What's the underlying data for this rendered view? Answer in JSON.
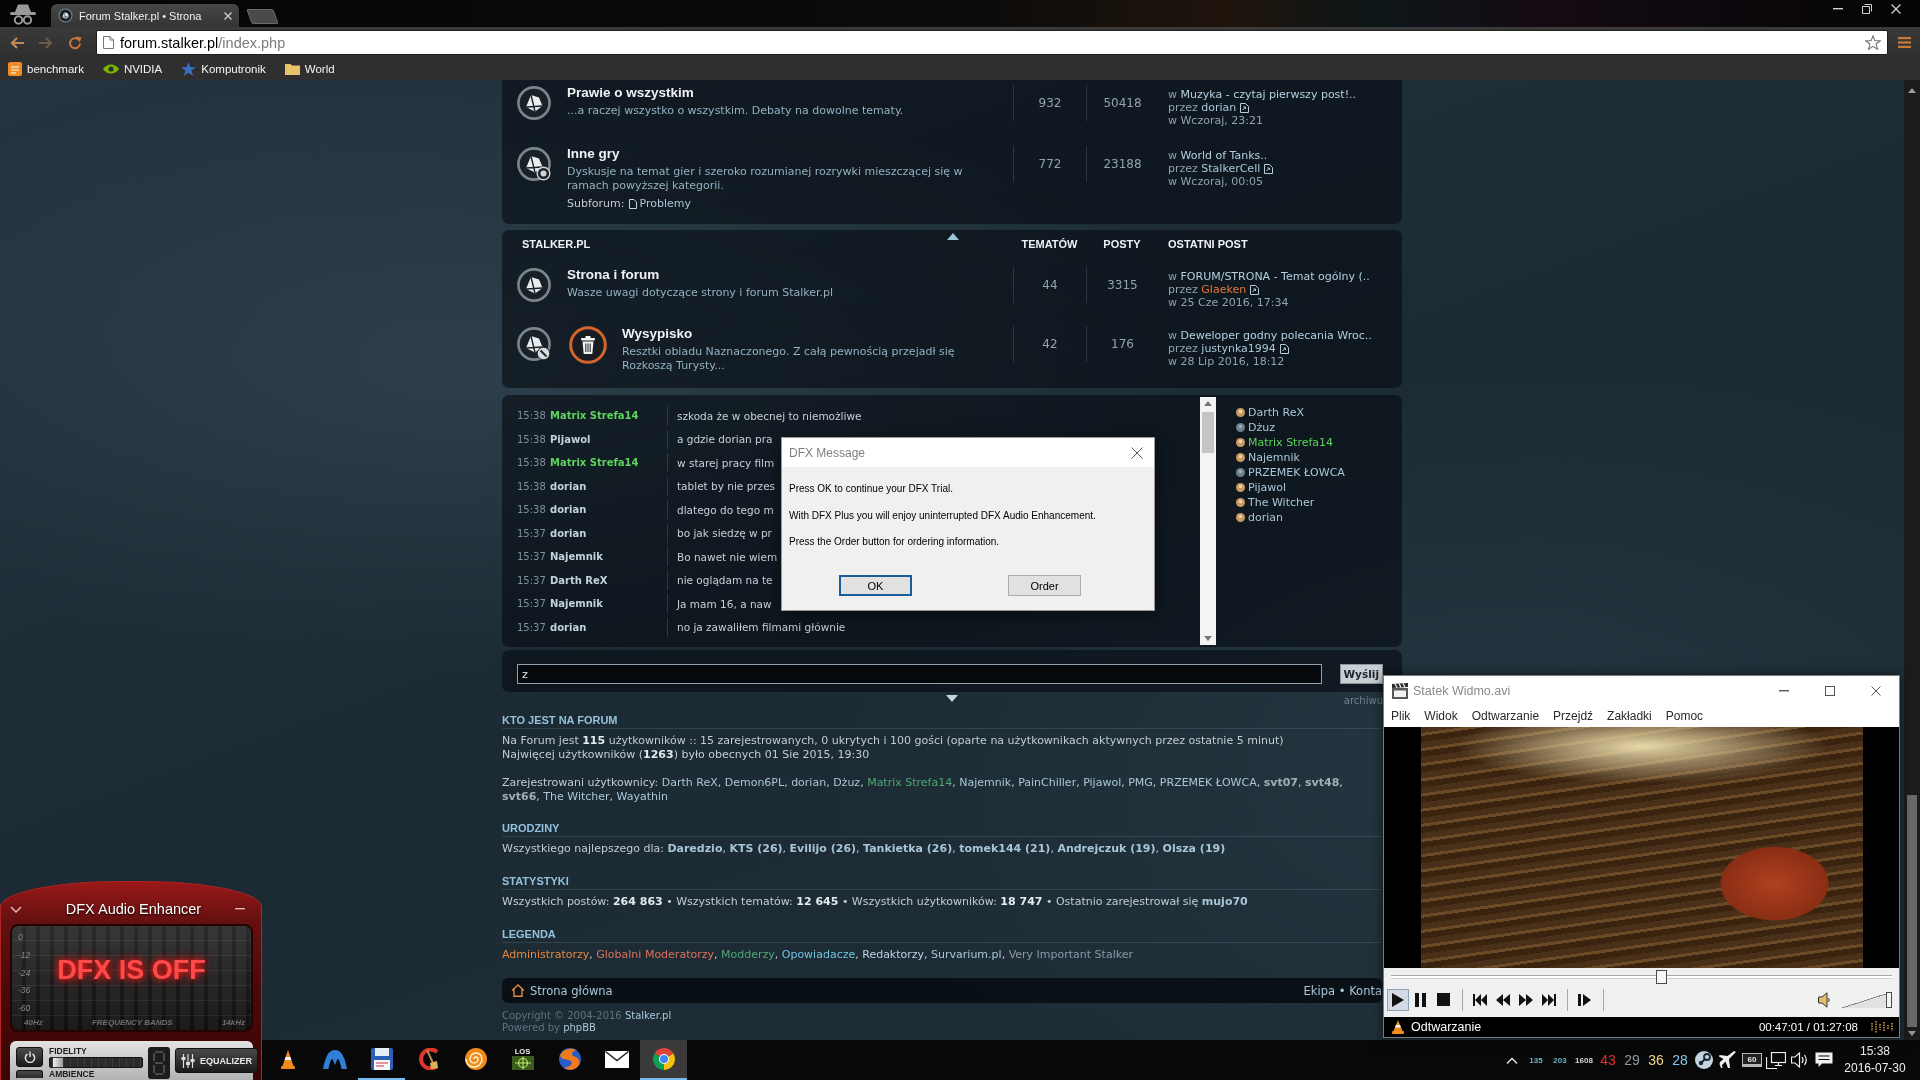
{
  "browser": {
    "tab": {
      "title": "Forum Stalker.pl • Strona"
    },
    "address": {
      "host": "forum.stalker.pl",
      "path": "/index.php"
    },
    "bookmarks": [
      {
        "label": "benchmark",
        "kind": "tile"
      },
      {
        "label": "NVIDIA",
        "kind": "eye"
      },
      {
        "label": "Komputronik",
        "kind": "star"
      },
      {
        "label": "World",
        "kind": "folder"
      }
    ]
  },
  "forums": [
    {
      "title": "Prawie o wszystkim",
      "kind": "plain",
      "description": "...a raczej wszystko o wszystkim. Debaty na dowolne tematy.",
      "topics": "932",
      "posts": "50418",
      "last_post": {
        "in": "w",
        "topic": "Muzyka - czytaj pierwszy post!..",
        "by": "przez",
        "author": {
          "name": "dorian",
          "color": "#a9c6d8"
        },
        "time": "w Wczoraj, 23:21"
      }
    },
    {
      "title": "Inne gry",
      "kind": "sub",
      "description": "Dyskusje na temat gier i szeroko rozumianej rozrywki mieszczącej się w ramach powyższej kategorii.",
      "subforum_label": "Subforum:",
      "subforums": [
        "Problemy"
      ],
      "topics": "772",
      "posts": "23188",
      "last_post": {
        "in": "w",
        "topic": "World of Tanks..",
        "by": "przez",
        "author": {
          "name": "StalkerCell",
          "color": "#a9c6d8"
        },
        "time": "w Wczoraj, 00:05"
      }
    }
  ],
  "category": {
    "title": "STALKER.PL",
    "columns": [
      "TEMATÓW",
      "POSTY",
      "OSTATNI POST"
    ],
    "forums": [
      {
        "title": "Strona i forum",
        "kind": "plain",
        "description": "Wasze uwagi dotyczące strony i forum Stalker.pl",
        "topics": "44",
        "posts": "3315",
        "last_post": {
          "in": "w",
          "topic": "FORUM/STRONA - Temat ogólny (..",
          "by": "przez",
          "author": {
            "name": "Glaeken",
            "color": "#e8753a"
          },
          "time": "w 25 Cze 2016, 17:34"
        }
      },
      {
        "title": "Wysypisko",
        "kind": "archive",
        "description": "Resztki obiadu Naznaczonego. Z całą pewnością przejadł się Rozkoszą Turysty...",
        "topics": "42",
        "posts": "176",
        "last_post": {
          "in": "w",
          "topic": "Deweloper godny polecania Wroc..",
          "by": "przez",
          "author": {
            "name": "justynka1994",
            "color": "#a9c6d8"
          },
          "time": "w 28 Lip 2016, 18:12"
        }
      }
    ]
  },
  "chat": {
    "messages": [
      {
        "time": "15:38",
        "user": "Matrix Strefa14",
        "color": "#5fd35f",
        "text": "szkoda że w obecnej to niemożliwe"
      },
      {
        "time": "15:38",
        "user": "Pijawol",
        "color": "#c4d2dc",
        "text": "a gdzie dorian pra"
      },
      {
        "time": "15:38",
        "user": "Matrix Strefa14",
        "color": "#5fd35f",
        "text": "w starej pracy film"
      },
      {
        "time": "15:38",
        "user": "dorian",
        "color": "#c4d2dc",
        "text": "tablet by nie przes"
      },
      {
        "time": "15:38",
        "user": "dorian",
        "color": "#c4d2dc",
        "text": "dlatego do tego m"
      },
      {
        "time": "15:37",
        "user": "dorian",
        "color": "#c4d2dc",
        "text": "bo jak siedzę w pr"
      },
      {
        "time": "15:37",
        "user": "Najemnik",
        "color": "#c4d2dc",
        "text": "Bo nawet nie wiem"
      },
      {
        "time": "15:37",
        "user": "Darth ReX",
        "color": "#c4d2dc",
        "text": "nie oglądam na te"
      },
      {
        "time": "15:37",
        "user": "Najemnik",
        "color": "#c4d2dc",
        "text": "Ja mam 16, a naw"
      },
      {
        "time": "15:37",
        "user": "dorian",
        "color": "#c4d2dc",
        "text": "no ja zawaliłem filmami głównie"
      }
    ],
    "online": [
      {
        "name": "Darth ReX",
        "color": "#a9c6d8",
        "idle": false
      },
      {
        "name": "Dżuz",
        "color": "#a9c6d8",
        "idle": true
      },
      {
        "name": "Matrix Strefa14",
        "color": "#5fd35f",
        "idle": false
      },
      {
        "name": "Najemnik",
        "color": "#a9c6d8",
        "idle": false
      },
      {
        "name": "PRZEMEK ŁOWCA",
        "color": "#a9c6d8",
        "idle": true
      },
      {
        "name": "Pijawol",
        "color": "#a9c6d8",
        "idle": false
      },
      {
        "name": "The Witcher",
        "color": "#a9c6d8",
        "idle": false
      },
      {
        "name": "dorian",
        "color": "#a9c6d8",
        "idle": false
      }
    ],
    "input": {
      "value": "z"
    },
    "send": "Wyślij",
    "archive": "archiwu"
  },
  "info": {
    "online": {
      "heading": "KTO JEST NA FORUM",
      "lines": [
        "Na Forum jest **115** użytkowników :: 15 zarejestrowanych, 0 ukrytych i 100 gości (oparte na użytkownikach aktywnych przez ostatnie 5 minut)",
        "Najwięcej użytkowników (**1263**) było obecnych 01 Sie 2015, 19:30"
      ],
      "registered_label": "Zarejestrowani użytkownicy:",
      "separator": ",",
      "registered": [
        {
          "name": "Darth ReX",
          "color": "#a9c6d8",
          "bold": false
        },
        {
          "name": "Demon6PL",
          "color": "#a9c6d8",
          "bold": false
        },
        {
          "name": "dorian",
          "color": "#a9c6d8",
          "bold": false
        },
        {
          "name": "Dżuz",
          "color": "#a9c6d8",
          "bold": false
        },
        {
          "name": "Matrix Strefa14",
          "color": "#4fa873",
          "bold": false
        },
        {
          "name": "Najemnik",
          "color": "#a9c6d8",
          "bold": false
        },
        {
          "name": "PainChiller",
          "color": "#a9c6d8",
          "bold": false
        },
        {
          "name": "Pijawol",
          "color": "#a9c6d8",
          "bold": false
        },
        {
          "name": "PMG",
          "color": "#a9c6d8",
          "bold": false
        },
        {
          "name": "PRZEMEK ŁOWCA",
          "color": "#a9c6d8",
          "bold": false
        },
        {
          "name": "svt07",
          "color": "#a3aeb6",
          "bold": true
        },
        {
          "name": "svt48",
          "color": "#a3aeb6",
          "bold": true
        },
        {
          "name": "svt66",
          "color": "#a3aeb6",
          "bold": true
        },
        {
          "name": "The Witcher",
          "color": "#a9c6d8",
          "bold": false
        },
        {
          "name": "Wayathin",
          "color": "#a9c6d8",
          "bold": false
        }
      ]
    },
    "birthdays": {
      "heading": "URODZINY",
      "label": "Wszystkiego najlepszego dla:",
      "separator": ",",
      "users": [
        "Daredzio",
        "KTS (26)",
        "Evilijo (26)",
        "Tankietka (26)",
        "tomek144 (21)",
        "Andrejczuk (19)",
        "Olsza (19)"
      ]
    },
    "stats": {
      "heading": "STATYSTYKI",
      "text": "Wszystkich postów: **264 863** • Wszystkich tematów: **12 645** • Wszystkich użytkowników: **18 747** • Ostatnio zarejestrował się",
      "newest": "mujo70"
    },
    "legend": {
      "heading": "LEGENDA",
      "separator": ",",
      "groups": [
        {
          "name": "Administratorzy",
          "color": "#e8873a"
        },
        {
          "name": "Globalni Moderatorzy",
          "color": "#d9735c"
        },
        {
          "name": "Modderzy",
          "color": "#4fa873"
        },
        {
          "name": "Opowiadacze",
          "color": "#72c3e3"
        },
        {
          "name": "Redaktorzy",
          "color": "#b9d3e2"
        },
        {
          "name": "Survarium.pl",
          "color": "#a9c6d8"
        },
        {
          "name": "Very Important Stalker",
          "color": "#8e98a8"
        }
      ]
    }
  },
  "footer": {
    "home": "Strona główna",
    "links": [
      "Ekipa",
      "Konta"
    ],
    "separator": "•",
    "copyright": "Copyright © 2004-2016",
    "copyright_link": "Stalker.pl",
    "powered": "Powered by",
    "powered_link": "phpBB"
  },
  "dialog": {
    "title": "DFX Message",
    "lines": [
      "Press OK to continue your DFX Trial.",
      "With DFX Plus you will enjoy uninterrupted DFX Audio Enhancement.",
      "Press the Order button for ordering information."
    ],
    "buttons": [
      {
        "label": "OK",
        "default": true
      },
      {
        "label": "Order",
        "default": false
      }
    ]
  },
  "player": {
    "title": "Statek Widmo.avi",
    "menu": [
      "Plik",
      "Widok",
      "Odtwarzanie",
      "Przejdź",
      "Zakładki",
      "Pomoc"
    ],
    "seek": {
      "level": 0.54
    },
    "controls": [
      [
        {
          "kind": "play",
          "pressed": true
        },
        {
          "kind": "pause",
          "pressed": false
        },
        {
          "kind": "stop",
          "pressed": false
        }
      ],
      [
        {
          "kind": "prev",
          "pressed": false
        },
        {
          "kind": "rewind",
          "pressed": false
        },
        {
          "kind": "forward",
          "pressed": false
        },
        {
          "kind": "next",
          "pressed": false
        }
      ],
      [
        {
          "kind": "step",
          "pressed": false
        }
      ]
    ],
    "volume": {
      "level": 1
    },
    "status": "Odtwarzanie",
    "time": "00:47:01 / 01:27:08"
  },
  "dfx": {
    "title": "DFX Audio Enhancer",
    "scale": [
      "0",
      "-12",
      "-24",
      "-36",
      "-60"
    ],
    "band_low": "40Hz",
    "bands_label": "FREQUENCY BANDS",
    "band_high": "14kHz",
    "status": "DFX IS OFF",
    "fidelity": {
      "label": "FIDELITY",
      "level": 0.03
    },
    "equalizer": "EQUALIZER",
    "ambience": "AMBIENCE"
  },
  "taskbar": {
    "apps": [
      {
        "kind": "cone",
        "running": false,
        "active": false
      },
      {
        "kind": "wing",
        "running": false,
        "active": false
      },
      {
        "kind": "floppy",
        "running": true,
        "active": false
      },
      {
        "kind": "broom",
        "running": false,
        "active": false
      },
      {
        "kind": "spiral",
        "running": false,
        "active": false
      },
      {
        "kind": "target",
        "label": "LOS",
        "running": false,
        "active": false
      },
      {
        "kind": "globe",
        "running": false,
        "active": false
      },
      {
        "kind": "envelope",
        "running": false,
        "active": false
      },
      {
        "kind": "wheel",
        "running": true,
        "active": true
      }
    ],
    "readings": [
      {
        "text": "135",
        "kind": "small",
        "color": "#6fb2c4"
      },
      {
        "text": "203",
        "kind": "small",
        "color": "#6fb2c4"
      },
      {
        "text": "1608",
        "kind": "small",
        "color": "#d0d8dc"
      },
      {
        "text": "43",
        "kind": "large",
        "color": "#e0322a"
      },
      {
        "text": "29",
        "kind": "large",
        "color": "#8c9aa4"
      },
      {
        "text": "36",
        "kind": "large",
        "color": "#ecd789"
      },
      {
        "text": "28",
        "kind": "large",
        "color": "#8cc4ec"
      }
    ],
    "tray": [
      {
        "kind": "disc"
      },
      {
        "kind": "plane"
      },
      {
        "kind": "monitor",
        "label": "60"
      },
      {
        "kind": "computer"
      },
      {
        "kind": "speaker"
      },
      {
        "kind": "message"
      }
    ],
    "clock": {
      "time": "15:38",
      "date": "2016-07-30"
    }
  }
}
